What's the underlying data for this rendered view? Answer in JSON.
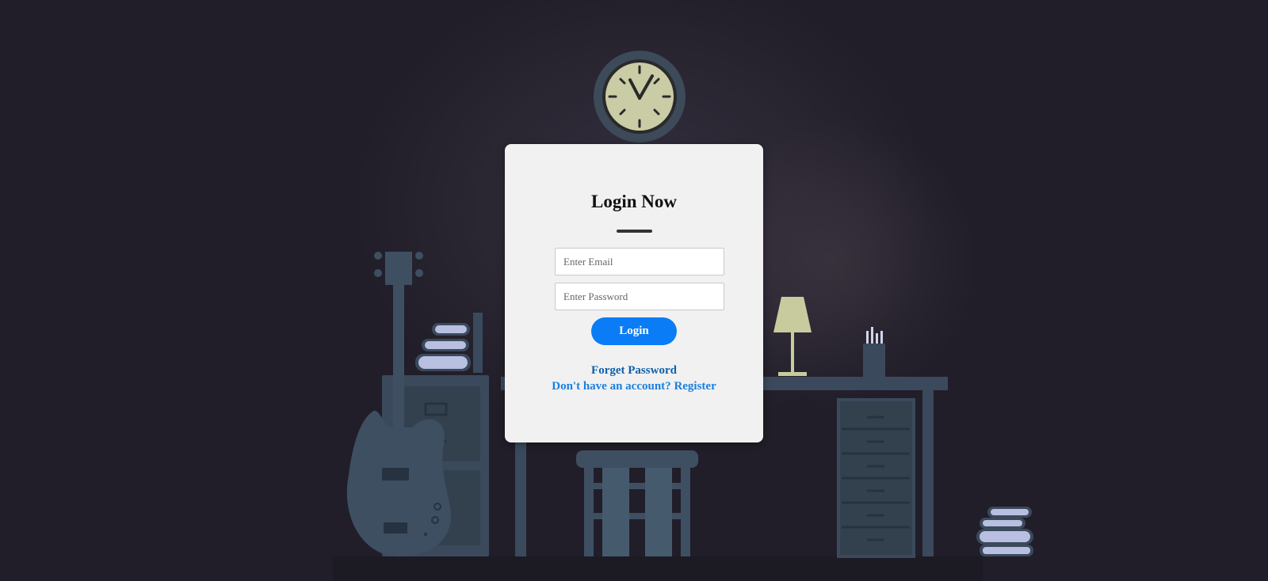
{
  "login": {
    "title": "Login Now",
    "email_placeholder": "Enter Email",
    "password_placeholder": "Enter Password",
    "login_label": "Login",
    "forgot_label": "Forget Password",
    "no_account_text": "Don't have an account?",
    "register_label": "Register"
  },
  "colors": {
    "background": "#211e29",
    "card": "#f1f1f1",
    "accent": "#0a7cf5",
    "link": "#1060a8",
    "furniture": "#3a4a5c",
    "clock_face": "#c9cca4"
  },
  "icons": [
    "clock-icon",
    "guitar-icon",
    "lamp-icon",
    "pencil-cup-icon",
    "books-icon"
  ]
}
